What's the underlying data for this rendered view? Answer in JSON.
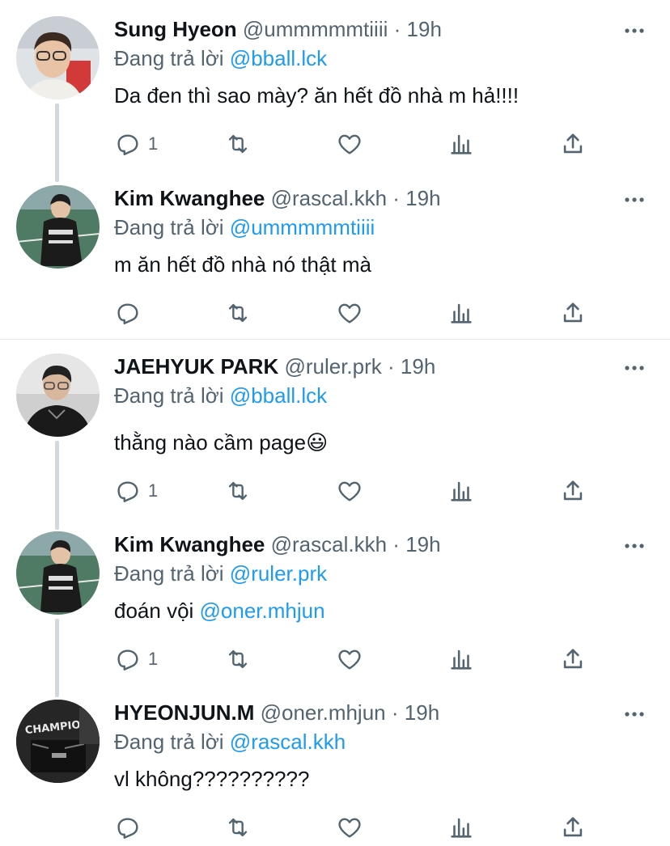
{
  "reply_prefix": "Đang trả lời",
  "separator": "·",
  "accent_color": "#1d9bf0",
  "icons": {
    "reply": "reply-icon",
    "retweet": "retweet-icon",
    "like": "heart-icon",
    "views": "analytics-icon",
    "share": "share-icon",
    "more": "more-icon"
  },
  "tweets": [
    {
      "name": "Sung Hyeon",
      "handle": "@ummmmmtiiii",
      "time": "19h",
      "reply_to": "@bball.lck",
      "text": "Da đen thì sao mày? ăn hết đồ nhà m hả!!!!",
      "reply_count": "1"
    },
    {
      "name": "Kim Kwanghee",
      "handle": "@rascal.kkh",
      "time": "19h",
      "reply_to": "@ummmmmtiiii",
      "text": "m ăn hết đồ nhà nó thật mà",
      "reply_count": ""
    },
    {
      "name": "JAEHYUK PARK",
      "handle": "@ruler.prk",
      "time": "19h",
      "reply_to": "@bball.lck",
      "text": "thằng nào cầm page",
      "emoji": "😃",
      "reply_count": "1"
    },
    {
      "name": "Kim Kwanghee",
      "handle": "@rascal.kkh",
      "time": "19h",
      "reply_to": "@ruler.prk",
      "text_prefix": "đoán vội ",
      "text_mention": "@oner.mhjun",
      "reply_count": "1"
    },
    {
      "name": "HYEONJUN.M",
      "handle": "@oner.mhjun",
      "time": "19h",
      "reply_to": "@rascal.kkh",
      "text": "vl không??????????",
      "avatar_text": "CHAMPION",
      "reply_count": ""
    }
  ]
}
